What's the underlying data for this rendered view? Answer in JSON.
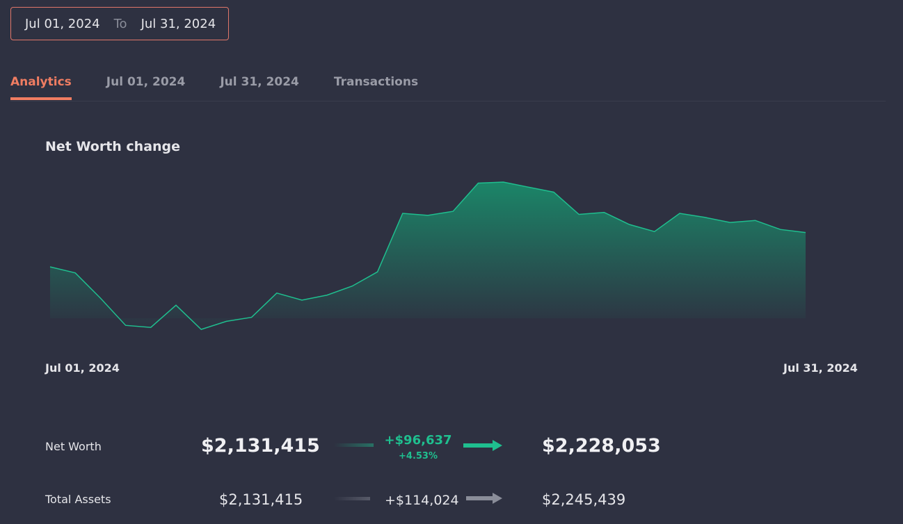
{
  "date_range": {
    "from": "Jul 01, 2024",
    "separator": "To",
    "to": "Jul 31, 2024",
    "border_color": "#e0776a"
  },
  "tabs": [
    {
      "label": "Analytics",
      "active": true
    },
    {
      "label": "Jul 01, 2024",
      "active": false
    },
    {
      "label": "Jul 31, 2024",
      "active": false
    },
    {
      "label": "Transactions",
      "active": false
    }
  ],
  "accent_color": "#f07d62",
  "positive_color": "#1fbf8f",
  "chart_data": {
    "type": "area",
    "title": "Net Worth change",
    "x_start_label": "Jul 01, 2024",
    "x_end_label": "Jul 31, 2024",
    "line_color": "#1fbf8f",
    "y_relative": [
      0.62,
      0.56,
      0.31,
      0.04,
      0.02,
      0.24,
      0.0,
      0.08,
      0.12,
      0.36,
      0.29,
      0.34,
      0.43,
      0.57,
      1.15,
      1.13,
      1.17,
      1.45,
      1.46,
      1.41,
      1.36,
      1.14,
      1.16,
      1.04,
      0.97,
      1.15,
      1.11,
      1.06,
      1.08,
      0.99,
      0.96
    ]
  },
  "summary": {
    "net_worth": {
      "label": "Net Worth",
      "start": "$2,131,415",
      "change": "+$96,637",
      "change_pct": "+4.53%",
      "end": "$2,228,053"
    },
    "total_assets": {
      "label": "Total Assets",
      "start": "$2,131,415",
      "change": "+$114,024",
      "end": "$2,245,439"
    }
  }
}
